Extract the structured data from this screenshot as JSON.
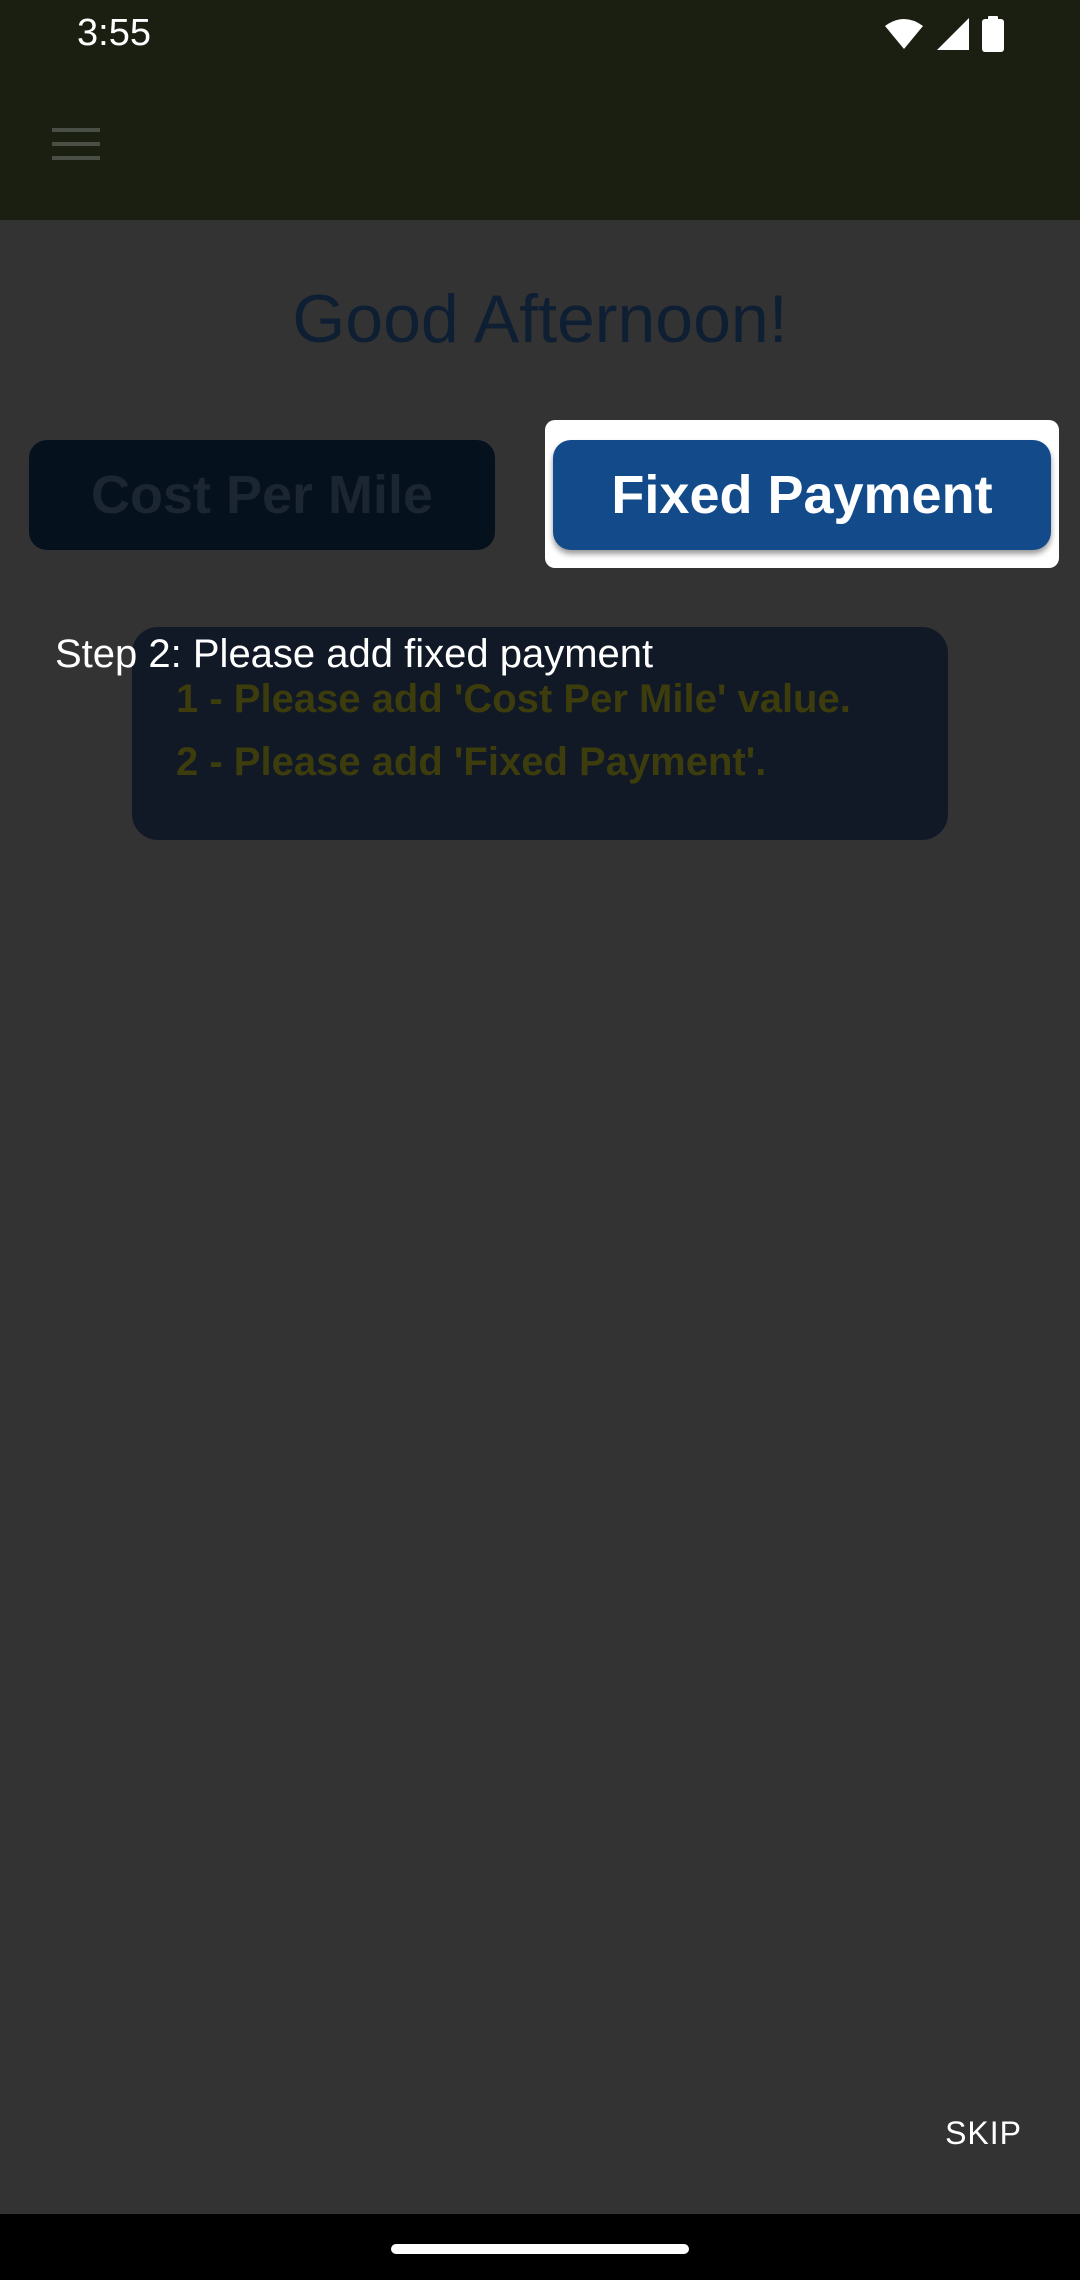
{
  "status_bar": {
    "time": "3:55",
    "icons": [
      "wifi-icon",
      "signal-icon",
      "battery-icon"
    ]
  },
  "app_bar": {
    "menu_icon": "hamburger-menu-icon"
  },
  "main": {
    "greeting": "Good Afternoon!",
    "cost_per_mile_label": "Cost Per Mile",
    "fixed_payment_label": "Fixed Payment",
    "info_lines": [
      "1 - Please add 'Cost Per Mile' value.",
      "2 - Please add 'Fixed Payment'."
    ]
  },
  "tutorial": {
    "step_text": "Step 2: Please add fixed payment",
    "skip_label": "SKIP"
  },
  "colors": {
    "app_bar_bg": "#1a1f12",
    "overlay_bg": "#333333",
    "fixed_payment_bg": "#134b8a",
    "info_text": "#3c3c0c"
  }
}
